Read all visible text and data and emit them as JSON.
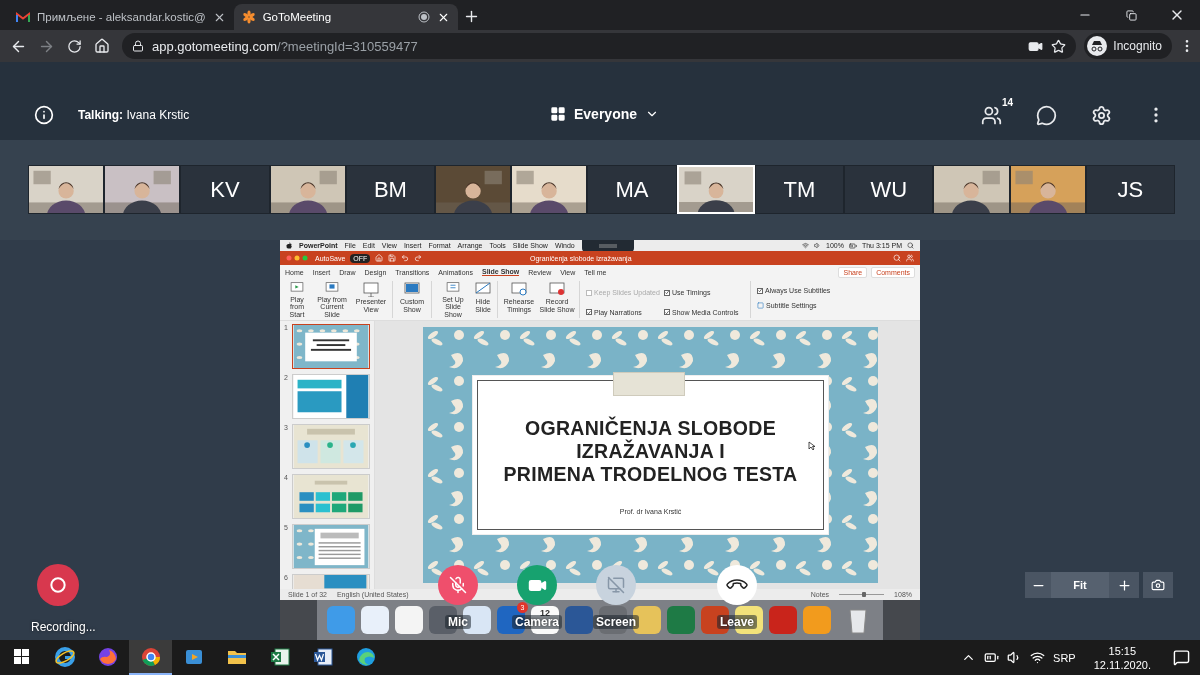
{
  "browser": {
    "tabs": [
      {
        "title": "Примљене - aleksandar.kostic@",
        "selected": false
      },
      {
        "title": "GoToMeeting",
        "selected": true
      }
    ],
    "url_host": "app.gotomeeting.com",
    "url_path": "/?meetingId=310559477",
    "profile": "Incognito"
  },
  "meeting": {
    "talking_label": "Talking:",
    "talking_name": "Ivana Krstic",
    "view": "Everyone",
    "participant_count": "14"
  },
  "participants": [
    {
      "kind": "video",
      "selected": false
    },
    {
      "kind": "video",
      "selected": false
    },
    {
      "kind": "initials",
      "initials": "KV",
      "selected": false
    },
    {
      "kind": "video",
      "selected": false
    },
    {
      "kind": "initials",
      "initials": "BM",
      "selected": false
    },
    {
      "kind": "video",
      "selected": false
    },
    {
      "kind": "video",
      "selected": false
    },
    {
      "kind": "initials",
      "initials": "MA",
      "selected": false
    },
    {
      "kind": "video",
      "selected": true
    },
    {
      "kind": "initials",
      "initials": "TM",
      "selected": false
    },
    {
      "kind": "initials",
      "initials": "WU",
      "selected": false
    },
    {
      "kind": "video",
      "selected": false
    },
    {
      "kind": "video",
      "selected": false
    },
    {
      "kind": "initials",
      "initials": "JS",
      "selected": false
    }
  ],
  "shared_screen": {
    "app_name": "PowerPoint",
    "menu": [
      "File",
      "Edit",
      "View",
      "Insert",
      "Format",
      "Arrange",
      "Tools",
      "Slide Show",
      "Windo"
    ],
    "battery": "100%",
    "clock": "Thu 3:15 PM",
    "autosave": "AutoSave",
    "autosave_toggle": "OFF",
    "document_title": "Ograničenja slobode izražavanja",
    "ribbon_tabs": [
      {
        "label": "Home",
        "selected": false
      },
      {
        "label": "Insert",
        "selected": false
      },
      {
        "label": "Draw",
        "selected": false
      },
      {
        "label": "Design",
        "selected": false
      },
      {
        "label": "Transitions",
        "selected": false
      },
      {
        "label": "Animations",
        "selected": false
      },
      {
        "label": "Slide Show",
        "selected": true
      },
      {
        "label": "Review",
        "selected": false
      },
      {
        "label": "View",
        "selected": false
      },
      {
        "label": "Tell me",
        "selected": false
      }
    ],
    "ribbon_buttons": [
      "Share",
      "Comments"
    ],
    "command_groups": [
      {
        "commands": [
          {
            "label": "Play from Start",
            "kind": "play"
          },
          {
            "label": "Play from Current Slide",
            "kind": "current"
          },
          {
            "label": "Presenter View",
            "kind": "presenter"
          }
        ]
      },
      {
        "commands": [
          {
            "label": "Custom Show",
            "kind": "custom"
          }
        ]
      },
      {
        "commands": [
          {
            "label": "Set Up Slide Show",
            "kind": "setup"
          },
          {
            "label": "Hide Slide",
            "kind": "hide"
          }
        ]
      },
      {
        "commands": [
          {
            "label": "Rehearse Timings",
            "kind": "rehearse"
          },
          {
            "label": "Record Slide Show",
            "kind": "record"
          }
        ]
      }
    ],
    "options": [
      {
        "label": "Keep Slides Updated",
        "checked": false,
        "disabled": true
      },
      {
        "label": "Use Timings",
        "checked": true,
        "disabled": false
      },
      {
        "label": "Play Narrations",
        "checked": true,
        "disabled": false
      },
      {
        "label": "Show Media Controls",
        "checked": true,
        "disabled": false
      }
    ],
    "subtitles": {
      "label": "Always Use Subtitles",
      "checked": true,
      "settings": "Subtitle Settings"
    },
    "thumbnails": [
      {
        "number": "1",
        "selected": true
      },
      {
        "number": "2",
        "selected": false
      },
      {
        "number": "3",
        "selected": false
      },
      {
        "number": "4",
        "selected": false
      },
      {
        "number": "5",
        "selected": false
      },
      {
        "number": "6",
        "selected": false
      }
    ],
    "slide": {
      "title_lines": [
        "OGRANIČENJA SLOBODE",
        "IZRAŽAVANJA I",
        "PRIMENA TRODELNOG TESTA"
      ],
      "subtitle": "Prof. dr Ivana Krstić"
    },
    "status": {
      "slide": "Slide 1 of 32",
      "language": "English (United States)",
      "notes": "Notes",
      "zoom": "108%"
    },
    "zoom_slider": {
      "level": 0.55
    },
    "dock": {
      "mail_badge": "3",
      "calendar_day": "12"
    }
  },
  "recording": {
    "label": "Recording..."
  },
  "controls": [
    {
      "kind": "mic",
      "label": "Mic",
      "active": false
    },
    {
      "kind": "camera",
      "label": "Camera",
      "active": true
    },
    {
      "kind": "screen",
      "label": "Screen",
      "active": false
    },
    {
      "kind": "leave",
      "label": "Leave",
      "active": true
    }
  ],
  "zoom_controls": {
    "fit": "Fit"
  },
  "taskbar": {
    "apps": [
      {
        "kind": "edge-old",
        "selected": false
      },
      {
        "kind": "fox",
        "selected": false
      },
      {
        "kind": "chrome",
        "selected": true
      },
      {
        "kind": "media",
        "selected": false
      },
      {
        "kind": "folder",
        "selected": false
      },
      {
        "kind": "sheet",
        "selected": false
      },
      {
        "kind": "doc",
        "selected": false
      },
      {
        "kind": "edge",
        "selected": false
      }
    ],
    "language": "SRP",
    "time": "15:15",
    "date": "12.11.2020."
  }
}
